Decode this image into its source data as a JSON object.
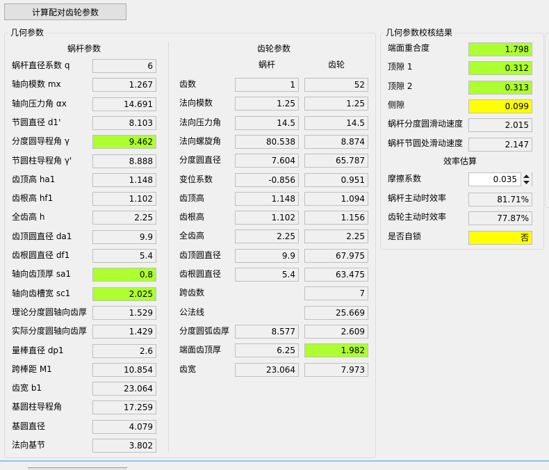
{
  "toolbar": {
    "calc_button": "计算配对齿轮参数"
  },
  "geom": {
    "title": "几何参数",
    "worm": {
      "header": "蜗杆参数",
      "rows": [
        {
          "label": "蜗杆直径系数 q",
          "value": "6",
          "hl": ""
        },
        {
          "label": "轴向模数 mx",
          "value": "1.267",
          "hl": ""
        },
        {
          "label": "轴向压力角 αx",
          "value": "14.691",
          "hl": ""
        },
        {
          "label": "节圆直径 d1'",
          "value": "8.103",
          "hl": ""
        },
        {
          "label": "分度圆导程角 γ",
          "value": "9.462",
          "hl": "green"
        },
        {
          "label": "节圆柱导程角 γ'",
          "value": "8.888",
          "hl": ""
        },
        {
          "label": "齿顶高 ha1",
          "value": "1.148",
          "hl": ""
        },
        {
          "label": "齿根高 hf1",
          "value": "1.102",
          "hl": ""
        },
        {
          "label": "全齿高 h",
          "value": "2.25",
          "hl": ""
        },
        {
          "label": "齿顶圆直径 da1",
          "value": "9.9",
          "hl": ""
        },
        {
          "label": "齿根圆直径 df1",
          "value": "5.4",
          "hl": ""
        },
        {
          "label": "轴向齿顶厚 sa1",
          "value": "0.8",
          "hl": "green"
        },
        {
          "label": "轴向齿槽宽 sc1",
          "value": "2.025",
          "hl": "green"
        },
        {
          "label": "理论分度圆轴向齿厚",
          "value": "1.529",
          "hl": ""
        },
        {
          "label": "实际分度圆轴向齿厚",
          "value": "1.429",
          "hl": ""
        },
        {
          "label": "量棒直径 dp1",
          "value": "2.6",
          "hl": ""
        },
        {
          "label": "跨棒距 M1",
          "value": "10.854",
          "hl": ""
        },
        {
          "label": "齿宽 b1",
          "value": "23.064",
          "hl": ""
        },
        {
          "label": "基圆柱导程角",
          "value": "17.259",
          "hl": ""
        },
        {
          "label": "基圆直径",
          "value": "4.079",
          "hl": ""
        },
        {
          "label": "法向基节",
          "value": "3.802",
          "hl": ""
        }
      ]
    },
    "gear": {
      "header": "齿轮参数",
      "col_worm": "蜗杆",
      "col_gear": "齿轮",
      "rows": [
        {
          "label": "齿数",
          "worm": "1",
          "gear": "52",
          "worm_hl": "",
          "gear_hl": ""
        },
        {
          "label": "法向模数",
          "worm": "1.25",
          "gear": "1.25",
          "worm_hl": "",
          "gear_hl": ""
        },
        {
          "label": "法向压力角",
          "worm": "14.5",
          "gear": "14.5",
          "worm_hl": "",
          "gear_hl": ""
        },
        {
          "label": "法向螺旋角",
          "worm": "80.538",
          "gear": "8.874",
          "worm_hl": "",
          "gear_hl": ""
        },
        {
          "label": "分度圆直径",
          "worm": "7.604",
          "gear": "65.787",
          "worm_hl": "",
          "gear_hl": ""
        },
        {
          "label": "变位系数",
          "worm": "-0.856",
          "gear": "0.951",
          "worm_hl": "",
          "gear_hl": ""
        },
        {
          "label": "齿顶高",
          "worm": "1.148",
          "gear": "1.094",
          "worm_hl": "",
          "gear_hl": ""
        },
        {
          "label": "齿根高",
          "worm": "1.102",
          "gear": "1.156",
          "worm_hl": "",
          "gear_hl": ""
        },
        {
          "label": "全齿高",
          "worm": "2.25",
          "gear": "2.25",
          "worm_hl": "",
          "gear_hl": ""
        },
        {
          "label": "齿顶圆直径",
          "worm": "9.9",
          "gear": "67.975",
          "worm_hl": "",
          "gear_hl": ""
        },
        {
          "label": "齿根圆直径",
          "worm": "5.4",
          "gear": "63.475",
          "worm_hl": "",
          "gear_hl": ""
        },
        {
          "label": "跨齿数",
          "worm": null,
          "gear": "7",
          "worm_hl": "",
          "gear_hl": ""
        },
        {
          "label": "公法线",
          "worm": null,
          "gear": "25.669",
          "worm_hl": "",
          "gear_hl": ""
        },
        {
          "label": "分度圆弧齿厚",
          "worm": "8.577",
          "gear": "2.609",
          "worm_hl": "",
          "gear_hl": ""
        },
        {
          "label": "端面齿顶厚",
          "worm": "6.25",
          "gear": "1.982",
          "worm_hl": "",
          "gear_hl": "green"
        },
        {
          "label": "齿宽",
          "worm": "23.064",
          "gear": "7.973",
          "worm_hl": "",
          "gear_hl": ""
        }
      ]
    }
  },
  "check": {
    "title": "几何参数校核结果",
    "rows": [
      {
        "label": "端面重合度",
        "value": "1.798",
        "hl": "green"
      },
      {
        "label": "顶隙 1",
        "value": "0.312",
        "hl": "green"
      },
      {
        "label": "顶隙 2",
        "value": "0.313",
        "hl": "green"
      },
      {
        "label": "侧隙",
        "value": "0.099",
        "hl": "yellow"
      },
      {
        "label": "蜗杆分度圆滑动速度",
        "value": "2.015",
        "hl": ""
      },
      {
        "label": "蜗杆节圆处滑动速度",
        "value": "2.147",
        "hl": ""
      }
    ],
    "efficiency_header": "效率估算",
    "friction": {
      "label": "摩擦系数",
      "value": "0.035"
    },
    "rows2": [
      {
        "label": "蜗杆主动时效率",
        "value": "81.71%",
        "hl": ""
      },
      {
        "label": "齿轮主动时效率",
        "value": "77.87%",
        "hl": ""
      },
      {
        "label": "是否自锁",
        "value": "否",
        "hl": "yellow"
      }
    ]
  },
  "colors": {
    "green": "#adff2f",
    "yellow": "#ffff00",
    "panel": "#f0f0f0"
  },
  "icons": [
    "chevron-up-icon",
    "chevron-down-icon"
  ]
}
